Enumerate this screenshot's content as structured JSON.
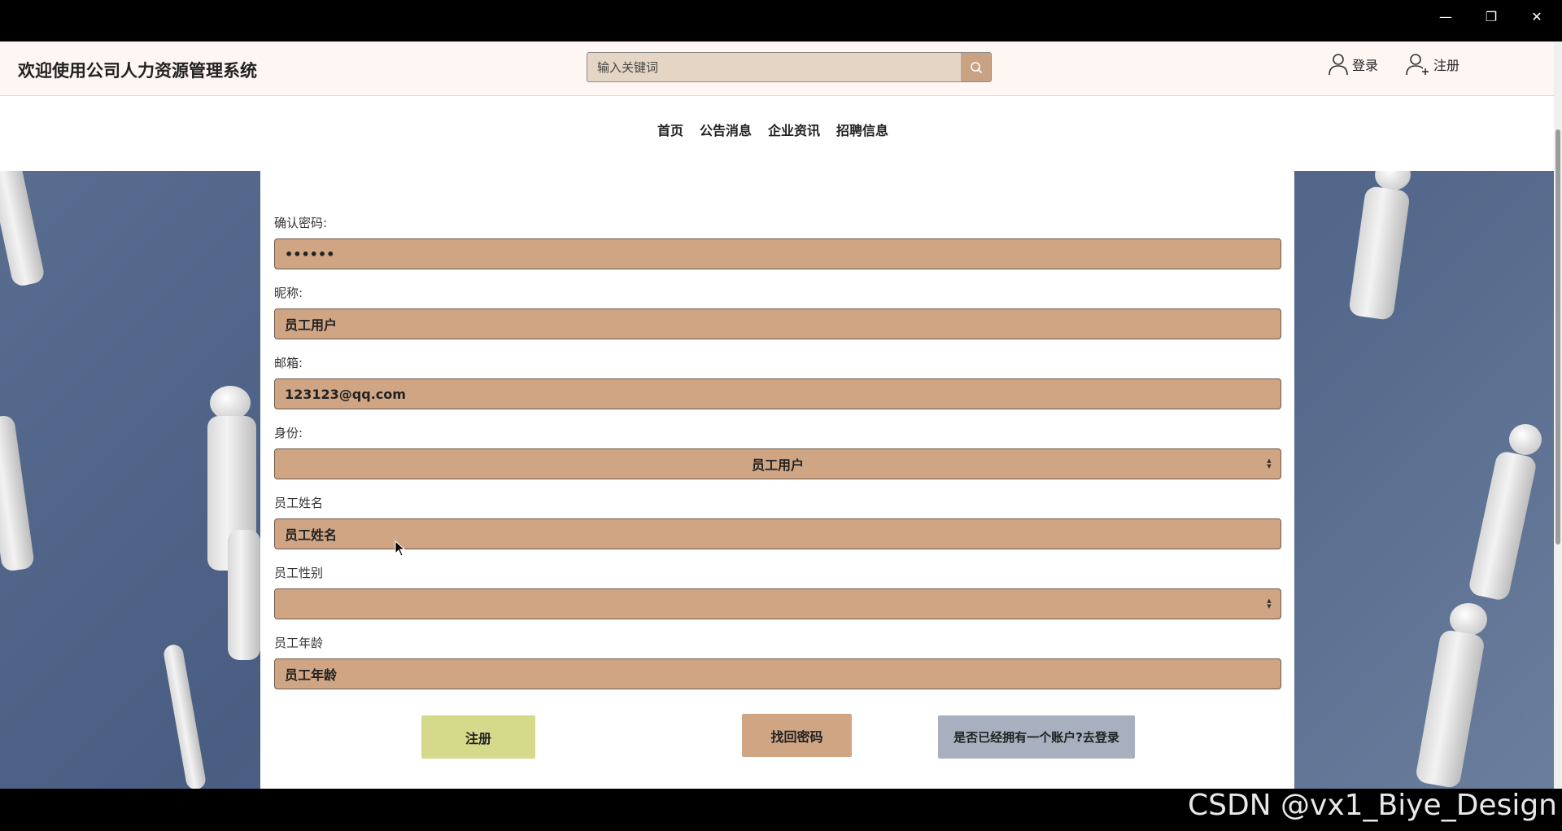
{
  "window": {
    "minimize_glyph": "—",
    "restore_glyph": "❐",
    "close_glyph": "✕"
  },
  "header": {
    "title": "欢迎使用公司人力资源管理系统",
    "search_placeholder": "输入关键词",
    "search_icon": "search-icon",
    "login_label": "登录",
    "register_label": "注册"
  },
  "nav": {
    "items": [
      "首页",
      "公告消息",
      "企业资讯",
      "招聘信息"
    ]
  },
  "form": {
    "confirm_password": {
      "label": "确认密码:",
      "value": "••••••"
    },
    "nickname": {
      "label": "昵称:",
      "value": "员工用户"
    },
    "email": {
      "label": "邮箱:",
      "value": "123123@qq.com"
    },
    "role": {
      "label": "身份:",
      "value": "员工用户"
    },
    "employee_name": {
      "label": "员工姓名",
      "value": "员工姓名"
    },
    "employee_gender": {
      "label": "员工性别",
      "value": ""
    },
    "employee_age": {
      "label": "员工年龄",
      "value": "员工年龄"
    }
  },
  "buttons": {
    "register": "注册",
    "forgot_password": "找回密码",
    "go_login": "是否已经拥有一个账户?去登录"
  },
  "watermark": "CSDN @vx1_Biye_Design",
  "colors": {
    "field_bg": "#cfa584",
    "register_btn": "#d5d98a",
    "login_btn": "#a8b0bf",
    "header_bg": "#fdf6f3"
  }
}
